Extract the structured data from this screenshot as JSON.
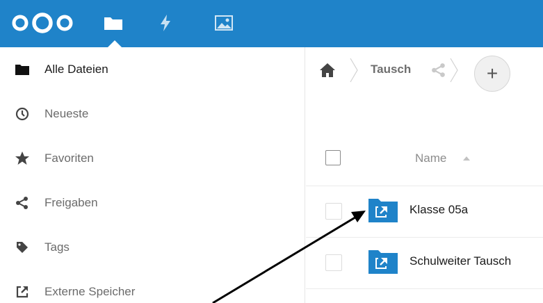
{
  "header": {
    "brand_color": "#1f83c9",
    "logo_icon": "nextcloud-logo",
    "apps": [
      {
        "icon": "folder-icon",
        "active": true
      },
      {
        "icon": "activity-bolt-icon",
        "active": false
      },
      {
        "icon": "gallery-image-icon",
        "active": false
      }
    ]
  },
  "sidebar": {
    "items": [
      {
        "label": "Alle Dateien",
        "icon": "folder-icon",
        "active": true
      },
      {
        "label": "Neueste",
        "icon": "clock-icon",
        "active": false
      },
      {
        "label": "Favoriten",
        "icon": "star-icon",
        "active": false
      },
      {
        "label": "Freigaben",
        "icon": "share-icon",
        "active": false
      },
      {
        "label": "Tags",
        "icon": "tag-icon",
        "active": false
      },
      {
        "label": "Externe Speicher",
        "icon": "external-link-icon",
        "active": false
      }
    ]
  },
  "breadcrumb": {
    "home_icon": "home-icon",
    "current": "Tausch",
    "share_icon": "share-icon",
    "add_label": "+"
  },
  "file_list": {
    "column_name": "Name",
    "sort_icon": "sort-ascending-icon",
    "rows": [
      {
        "name": "Klasse 05a",
        "icon": "shared-folder-icon"
      },
      {
        "name": "Schulweiter Tausch",
        "icon": "shared-folder-icon"
      }
    ]
  },
  "colors": {
    "folder": "#1f83c9",
    "annotation_arrow": "#000000"
  }
}
